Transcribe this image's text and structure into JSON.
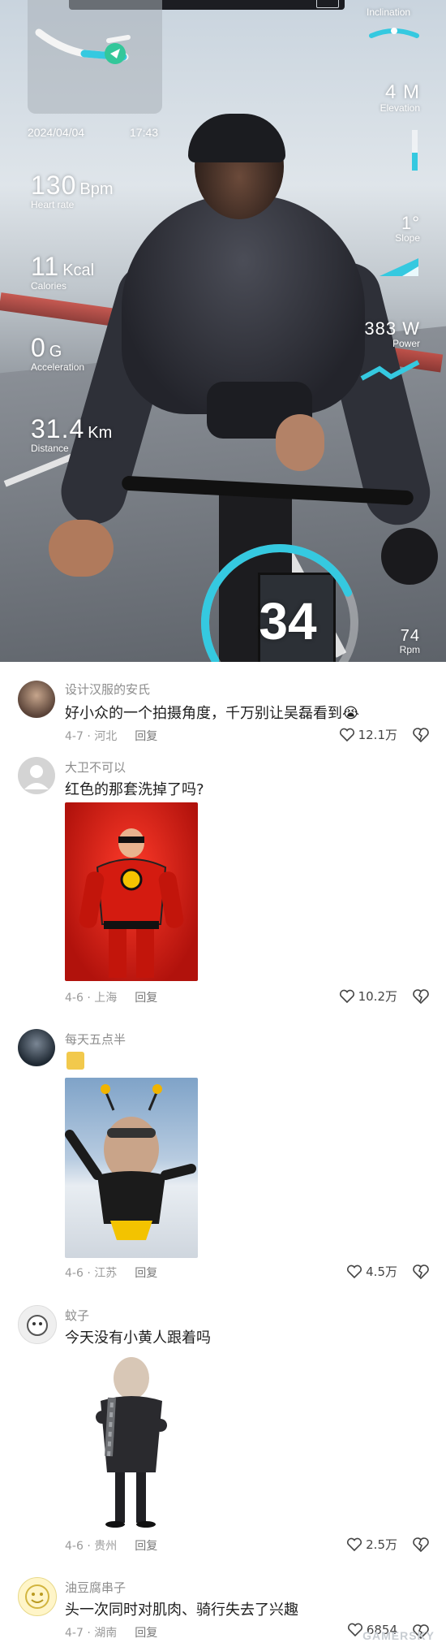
{
  "video": {
    "top_label": "Inclination",
    "date": "2024/04/04",
    "time": "17:43",
    "heart_rate": {
      "value": "130",
      "unit": "Bpm",
      "label": "Heart rate"
    },
    "calories": {
      "value": "11",
      "unit": "Kcal",
      "label": "Calories"
    },
    "acceleration": {
      "value": "0",
      "unit": "G",
      "label": "Acceleration"
    },
    "distance": {
      "value": "31.4",
      "unit": "Km",
      "label": "Distance"
    },
    "elevation": {
      "value": "4 M",
      "label": "Elevation",
      "level": 0.45
    },
    "slope": {
      "value": "1°",
      "label": "Slope"
    },
    "power": {
      "value": "383 W",
      "label": "Power"
    },
    "speed": {
      "value": "34",
      "level": 0.62
    },
    "cadence": {
      "value": "74",
      "label": "Rpm"
    },
    "accent_color": "#35c9e0"
  },
  "comments": [
    {
      "user": "设计汉服的安氏",
      "text": "好小众的一个拍摄角度，千万别让吴磊看到😭",
      "date": "4-7",
      "location": "河北",
      "reply": "回复",
      "likes": "12.1万"
    },
    {
      "user": "大卫不可以",
      "text": "红色的那套洗掉了吗?",
      "date": "4-6",
      "location": "上海",
      "reply": "回复",
      "likes": "10.2万"
    },
    {
      "user": "每天五点半",
      "text": "",
      "date": "4-6",
      "location": "江苏",
      "reply": "回复",
      "likes": "4.5万"
    },
    {
      "user": "蚊子",
      "text": "今天没有小黄人跟着吗",
      "date": "4-6",
      "location": "贵州",
      "reply": "回复",
      "likes": "2.5万"
    },
    {
      "user": "油豆腐串子",
      "text": "头一次同时对肌肉、骑行失去了兴趣",
      "date": "4-7",
      "location": "湖南",
      "reply": "回复",
      "likes": "6854"
    }
  ],
  "watermark": "GAMERSKY"
}
